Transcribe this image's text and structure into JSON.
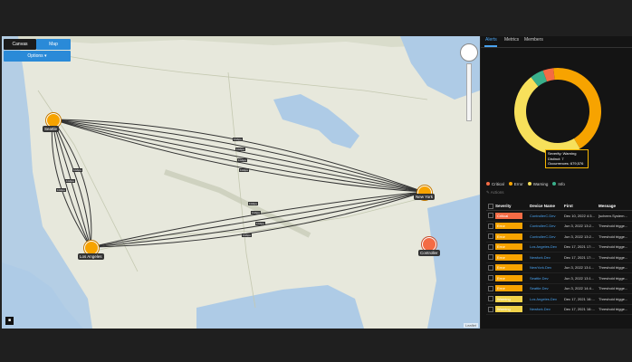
{
  "map": {
    "toggle": {
      "canvas": "Canvas",
      "map": "Map"
    },
    "options_label": "Options ▾",
    "corner_label": "■",
    "attribution": "Leaflet",
    "nodes": [
      {
        "label": "Seattle"
      },
      {
        "label": "Los Angeles"
      },
      {
        "label": "New York"
      },
      {
        "label": "Controller"
      }
    ],
    "edge_tag": "1Gbps",
    "colors": {
      "node": "#f7a300",
      "node_critical": "#f46b45"
    }
  },
  "panel": {
    "tabs": [
      "Alerts",
      "Metrics",
      "Members"
    ],
    "chart_data": {
      "type": "pie",
      "categories": [
        "Critical",
        "Error",
        "Warning",
        "Info"
      ],
      "values": [
        4,
        43,
        48,
        5
      ],
      "colors": [
        "#f46b45",
        "#f7a300",
        "#f7e05b",
        "#3ab08b"
      ],
      "tooltip": {
        "severity": "Severity: Warning",
        "distinct": "Distinct: 7",
        "occurrences": "Occurrences: 679,576"
      }
    },
    "legend": [
      "Critical",
      "Error",
      "Warning",
      "Info"
    ],
    "actions_label": "✎ Actions",
    "grid": {
      "columns": [
        "Severity",
        "Device Name",
        "First",
        "Message"
      ],
      "rows": [
        {
          "severity": "Critical",
          "device": "ControllerC.Dev",
          "first": "Dec 10, 2022 4:3...",
          "message": "[scheen.System..."
        },
        {
          "severity": "Error",
          "device": "ControllerC.Dev",
          "first": "Jun 3, 2022 13:2...",
          "message": "Threshold trigge..."
        },
        {
          "severity": "Error",
          "device": "ControllerC.Dev",
          "first": "Jun 3, 2022 13:2...",
          "message": "Threshold trigge..."
        },
        {
          "severity": "Error",
          "device": "Los Angeles.Dev",
          "first": "Dec 17, 2021 17:...",
          "message": "Threshold trigge..."
        },
        {
          "severity": "Error",
          "device": "Newfork.Dev",
          "first": "Dec 17, 2021 17:...",
          "message": "Threshold trigge..."
        },
        {
          "severity": "Error",
          "device": "NewYork.Dev",
          "first": "Jun 3, 2022 13:1...",
          "message": "Threshold trigge..."
        },
        {
          "severity": "Error",
          "device": "Seattle.Dev",
          "first": "Jun 3, 2022 13:1...",
          "message": "Threshold trigge..."
        },
        {
          "severity": "Error",
          "device": "Seattle.Dev",
          "first": "Jun 3, 2022 14:4...",
          "message": "Threshold trigge..."
        },
        {
          "severity": "Warning",
          "device": "Los Angeles.Dev",
          "first": "Dec 17, 2021 16:...",
          "message": "Threshold trigge..."
        },
        {
          "severity": "Warning",
          "device": "Newfork.Dev",
          "first": "Dec 17, 2021 16:...",
          "message": "Threshold trigge..."
        }
      ]
    }
  }
}
